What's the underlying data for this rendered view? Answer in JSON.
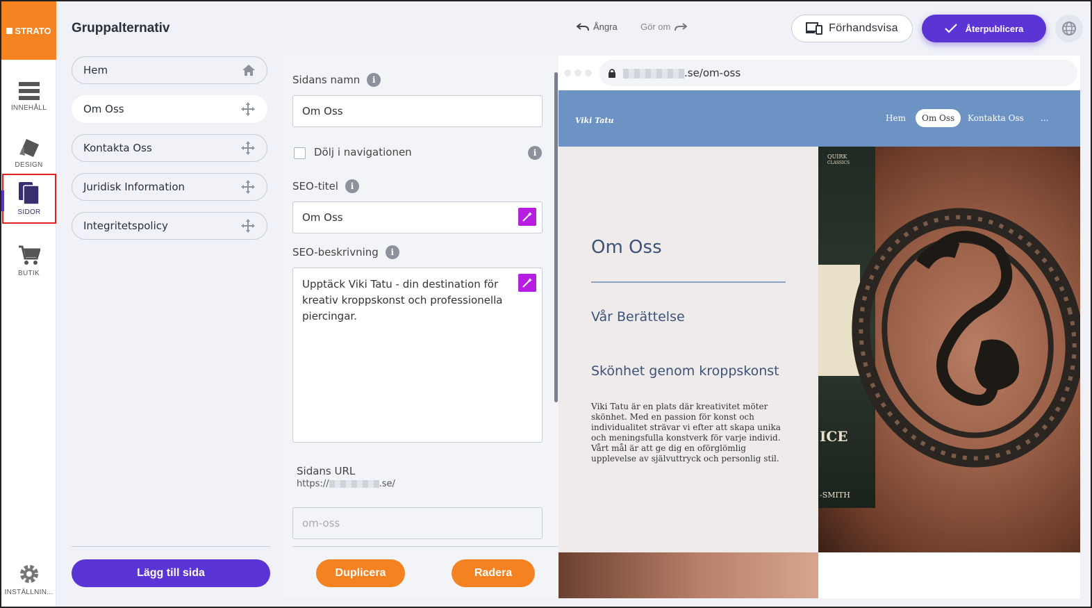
{
  "brand": {
    "name": "STRATO"
  },
  "rail": {
    "items": [
      {
        "label": "INNEHÅLL",
        "icon": "content-icon"
      },
      {
        "label": "DESIGN",
        "icon": "design-icon"
      },
      {
        "label": "SIDOR",
        "icon": "pages-icon",
        "active": true
      },
      {
        "label": "BUTIK",
        "icon": "cart-icon"
      }
    ],
    "settings_label": "INSTÄLLNIN..."
  },
  "header": {
    "title": "Gruppalternativ",
    "undo": "Ångra",
    "redo": "Gör om",
    "preview": "Förhandsvisa",
    "publish": "Återpublicera"
  },
  "pages": {
    "items": [
      {
        "label": "Hem",
        "icon": "home-icon"
      },
      {
        "label": "Om Oss",
        "icon": "move-icon",
        "selected": true
      },
      {
        "label": "Kontakta Oss",
        "icon": "move-icon"
      },
      {
        "label": "Juridisk Information",
        "icon": "move-icon"
      },
      {
        "label": "Integritetspolicy",
        "icon": "move-icon"
      }
    ],
    "add_button": "Lägg till sida"
  },
  "form": {
    "name_label": "Sidans namn",
    "name_value": "Om Oss",
    "hide_nav_label": "Dölj i navigationen",
    "hide_nav_checked": false,
    "seo_title_label": "SEO-titel",
    "seo_title_value": "Om Oss",
    "seo_desc_label": "SEO-beskrivning",
    "seo_desc_value": "Upptäck Viki Tatu - din destination för kreativ kroppskonst och professionella piercingar.",
    "url_label": "Sidans URL",
    "url_prefix": "https://",
    "url_suffix": ".se/",
    "slug_placeholder": "om-oss",
    "duplicate": "Duplicera",
    "delete": "Radera"
  },
  "preview": {
    "address_suffix": ".se/om-oss",
    "site_logo": "Viki Tatu",
    "nav": [
      "Hem",
      "Om Oss",
      "Kontakta Oss",
      "..."
    ],
    "heading": "Om Oss",
    "subheading": "Vår Berättelse",
    "section_title": "Skönhet genom kroppskonst",
    "body": "Viki Tatu är en plats där kreativitet möter skönhet. Med en passion för konst och individualitet strävar vi efter att skapa unika och meningsfulla konstverk för varje individ. Vårt mål är att ge dig en oförglömlig upplevelse av självuttryck och personlig stil.",
    "card_brand_1": "QUIRK",
    "card_brand_2": "CLASSICS",
    "card_word": "ICE",
    "card_name": "-SMITH"
  },
  "colors": {
    "accent": "#5b34d6",
    "brand_orange": "#f58220",
    "site_nav": "#6c93c4",
    "magic": "#b61ee0"
  }
}
